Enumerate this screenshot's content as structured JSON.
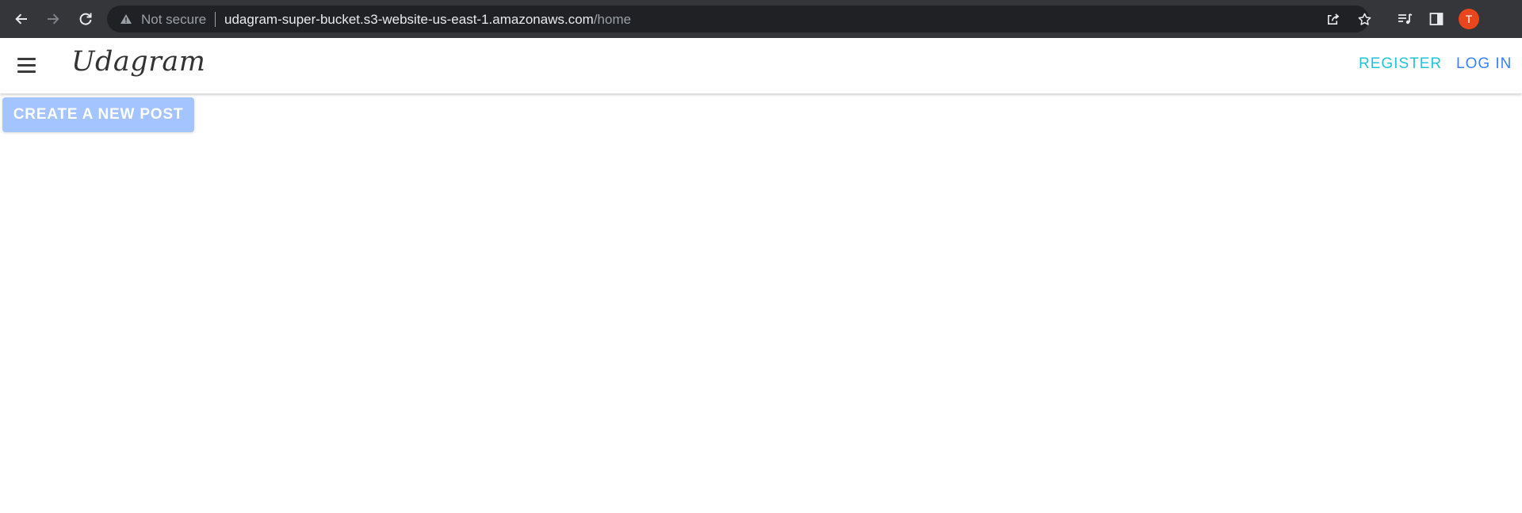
{
  "browser": {
    "security_label": "Not secure",
    "url_host": "udagram-super-bucket.s3-website-us-east-1.amazonaws.com",
    "url_path": "/home",
    "profile_initial": "T",
    "icons": [
      "back-arrow-icon",
      "forward-arrow-icon",
      "reload-icon",
      "warning-icon",
      "share-icon",
      "star-icon",
      "media-queue-icon",
      "side-panel-icon"
    ],
    "colors": {
      "chrome_bg": "#35363a",
      "omnibox_bg": "#202124",
      "avatar_bg": "#e8471d"
    }
  },
  "app": {
    "title": "Udagram",
    "nav": {
      "register": "REGISTER",
      "login": "LOG IN"
    },
    "create_post_label": "CREATE A NEW POST",
    "colors": {
      "register": "#20c4d8",
      "login": "#3880ff",
      "create_button": "#a4c4ff"
    }
  }
}
